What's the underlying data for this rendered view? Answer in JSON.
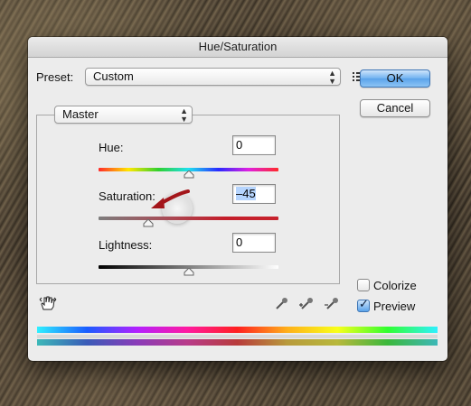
{
  "dialog": {
    "title": "Hue/Saturation",
    "preset_label": "Preset:",
    "preset_value": "Custom",
    "ok_label": "OK",
    "cancel_label": "Cancel",
    "channel_value": "Master",
    "hue": {
      "label": "Hue:",
      "value": "0",
      "slider_fraction": 0.5
    },
    "saturation": {
      "label": "Saturation:",
      "value": "–45",
      "slider_fraction": 0.275
    },
    "lightness": {
      "label": "Lightness:",
      "value": "0",
      "slider_fraction": 0.5
    },
    "colorize_label": "Colorize",
    "colorize_checked": false,
    "preview_label": "Preview",
    "preview_checked": true
  },
  "icons": {
    "preset_menu": "preset-options-icon",
    "hand": "on-image-adjust-hand-icon",
    "eyedropper": "eyedropper-icon",
    "eyedropper_plus": "eyedropper-plus-icon",
    "eyedropper_minus": "eyedropper-minus-icon"
  },
  "colors": {
    "ok_button": "#6fb1f0",
    "annotation_arrow": "#a3151a",
    "saturation_track": "#c41e2a"
  }
}
